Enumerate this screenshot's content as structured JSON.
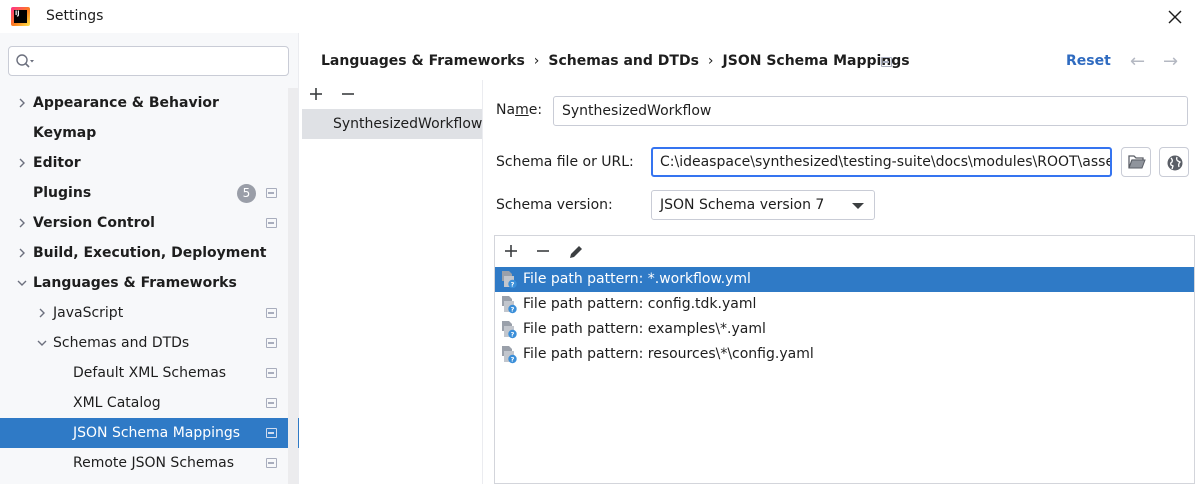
{
  "window": {
    "title": "Settings",
    "logo_text": "IJ"
  },
  "sidebar": {
    "search_placeholder": "",
    "items": [
      {
        "label": "Appearance & Behavior",
        "bold": true,
        "expandable": true,
        "expanded": false,
        "level": 0,
        "project": false
      },
      {
        "label": "Keymap",
        "bold": true,
        "expandable": false,
        "level": 0,
        "project": false
      },
      {
        "label": "Editor",
        "bold": true,
        "expandable": true,
        "expanded": false,
        "level": 0,
        "project": false
      },
      {
        "label": "Plugins",
        "bold": true,
        "expandable": false,
        "level": 0,
        "badge": "5",
        "project": true
      },
      {
        "label": "Version Control",
        "bold": true,
        "expandable": true,
        "expanded": false,
        "level": 0,
        "project": true
      },
      {
        "label": "Build, Execution, Deployment",
        "bold": true,
        "expandable": true,
        "expanded": false,
        "level": 0,
        "project": false
      },
      {
        "label": "Languages & Frameworks",
        "bold": true,
        "expandable": true,
        "expanded": true,
        "level": 0,
        "project": false
      },
      {
        "label": "JavaScript",
        "bold": false,
        "expandable": true,
        "expanded": false,
        "level": 1,
        "project": true
      },
      {
        "label": "Schemas and DTDs",
        "bold": false,
        "expandable": true,
        "expanded": true,
        "level": 1,
        "project": true
      },
      {
        "label": "Default XML Schemas",
        "bold": false,
        "expandable": false,
        "level": 2,
        "project": true
      },
      {
        "label": "XML Catalog",
        "bold": false,
        "expandable": false,
        "level": 2,
        "project": true
      },
      {
        "label": "JSON Schema Mappings",
        "bold": false,
        "expandable": false,
        "level": 2,
        "project": true,
        "selected": true
      },
      {
        "label": "Remote JSON Schemas",
        "bold": false,
        "expandable": false,
        "level": 2,
        "project": true
      }
    ]
  },
  "breadcrumb": {
    "items": [
      "Languages & Frameworks",
      "Schemas and DTDs",
      "JSON Schema Mappings"
    ],
    "separator": "›"
  },
  "header": {
    "reset_label": "Reset",
    "back_arrow": "←",
    "forward_arrow": "→"
  },
  "mappings": {
    "items": [
      "SynthesizedWorkflow"
    ]
  },
  "form": {
    "name_label_pre": "Na",
    "name_label_mnemonic": "m",
    "name_label_post": "e:",
    "name_value": "SynthesizedWorkflow",
    "schema_label": "Schema file or URL:",
    "schema_value": "C:\\ideaspace\\synthesized\\testing-suite\\docs\\modules\\ROOT\\assets",
    "version_label": "Schema version:",
    "version_value": "JSON Schema version 7"
  },
  "patterns": [
    {
      "label": "File path pattern: *.workflow.yml",
      "selected": true
    },
    {
      "label": "File path pattern: config.tdk.yaml",
      "selected": false
    },
    {
      "label": "File path pattern: examples\\*.yaml",
      "selected": false
    },
    {
      "label": "File path pattern: resources\\*\\config.yaml",
      "selected": false
    }
  ],
  "colors": {
    "selection": "#2f7ac6",
    "link": "#2f6bc0",
    "focus": "#3574f0"
  }
}
